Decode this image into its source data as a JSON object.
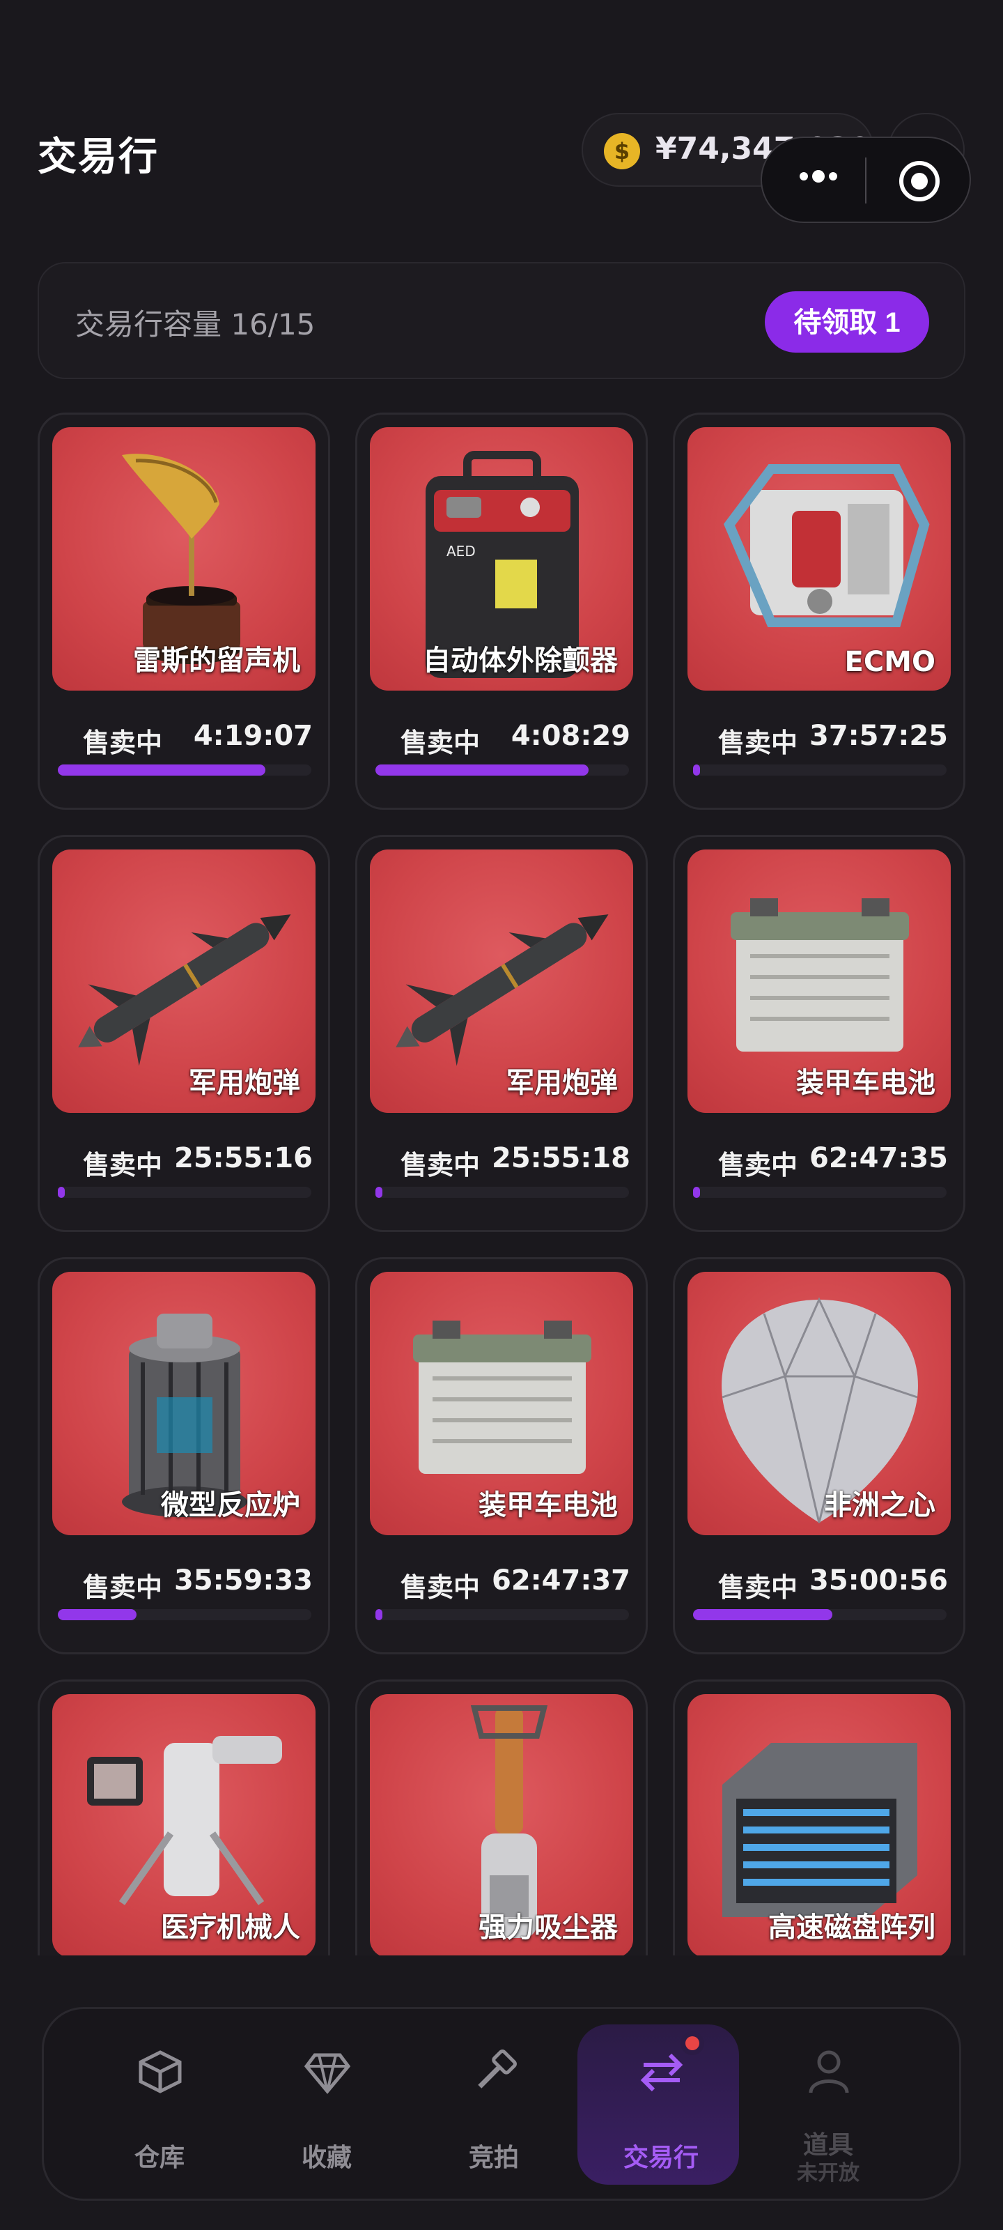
{
  "header": {
    "title": "交易行",
    "balance": "¥74,347,030",
    "add_label": "+"
  },
  "capacity": {
    "label": "交易行容量 16/15",
    "claim_label": "待领取 1"
  },
  "status_label": "售卖中",
  "listings": [
    {
      "name": "雷斯的留声机",
      "time": "4:19:07",
      "progress": 0.82,
      "icon": "gramophone-icon"
    },
    {
      "name": "自动体外除颤器",
      "time": "4:08:29",
      "progress": 0.84,
      "icon": "defibrillator-icon"
    },
    {
      "name": "ECMO",
      "time": "37:57:25",
      "progress": 0.02,
      "icon": "ecmo-machine-icon"
    },
    {
      "name": "军用炮弹",
      "time": "25:55:16",
      "progress": 0.02,
      "icon": "missile-icon"
    },
    {
      "name": "军用炮弹",
      "time": "25:55:18",
      "progress": 0.02,
      "icon": "missile-icon"
    },
    {
      "name": "装甲车电池",
      "time": "62:47:35",
      "progress": 0.02,
      "icon": "battery-icon"
    },
    {
      "name": "微型反应炉",
      "time": "35:59:33",
      "progress": 0.31,
      "icon": "reactor-icon"
    },
    {
      "name": "装甲车电池",
      "time": "62:47:37",
      "progress": 0.02,
      "icon": "battery-icon"
    },
    {
      "name": "非洲之心",
      "time": "35:00:56",
      "progress": 0.55,
      "icon": "diamond-icon"
    },
    {
      "name": "医疗机械人",
      "time": "",
      "progress": 0,
      "icon": "medical-robot-icon"
    },
    {
      "name": "强力吸尘器",
      "time": "",
      "progress": 0,
      "icon": "vacuum-icon"
    },
    {
      "name": "高速磁盘阵列",
      "time": "",
      "progress": 0,
      "icon": "disk-array-icon"
    }
  ],
  "nav": [
    {
      "label": "仓库",
      "icon": "box-icon"
    },
    {
      "label": "收藏",
      "icon": "gem-icon"
    },
    {
      "label": "竞拍",
      "icon": "gavel-icon"
    },
    {
      "label": "交易行",
      "icon": "exchange-icon",
      "active": true
    },
    {
      "label": "道具",
      "sub": "未开放",
      "icon": "user-icon",
      "disabled": true
    }
  ],
  "colors": {
    "accent": "#8b2be8",
    "card_bg": "#cf4449",
    "background": "#1a181d"
  }
}
